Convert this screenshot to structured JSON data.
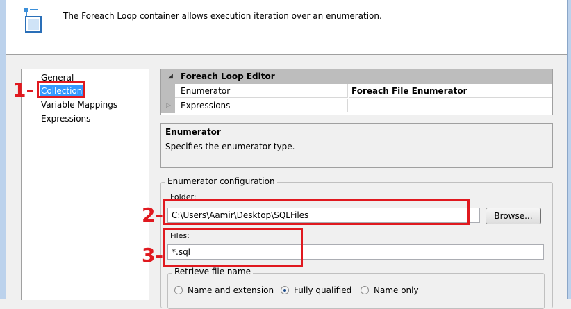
{
  "header": {
    "description": "The Foreach Loop container allows execution iteration over an enumeration.",
    "icon": "foreach-loop-icon"
  },
  "nav": {
    "items": [
      {
        "label": "General",
        "selected": false
      },
      {
        "label": "Collection",
        "selected": true
      },
      {
        "label": "Variable Mappings",
        "selected": false
      },
      {
        "label": "Expressions",
        "selected": false
      }
    ]
  },
  "property_grid": {
    "category": "Foreach Loop Editor",
    "rows": [
      {
        "name": "Enumerator",
        "value": "Foreach File Enumerator"
      },
      {
        "name": "Expressions",
        "value": ""
      }
    ]
  },
  "description_pane": {
    "title": "Enumerator",
    "text": "Specifies the enumerator type."
  },
  "enumerator_config": {
    "title": "Enumerator configuration",
    "folder_label": "Folder:",
    "folder_value": "C:\\Users\\Aamir\\Desktop\\SQLFiles",
    "browse_label": "Browse...",
    "files_label": "Files:",
    "files_value": "*.sql",
    "retrieve": {
      "title": "Retrieve file name",
      "options": [
        {
          "label": "Name and extension",
          "checked": false
        },
        {
          "label": "Fully qualified",
          "checked": true
        },
        {
          "label": "Name only",
          "checked": false
        }
      ]
    }
  },
  "annotations": {
    "one": "1-",
    "two": "2-",
    "three": "3-",
    "color": "#e0191f"
  }
}
